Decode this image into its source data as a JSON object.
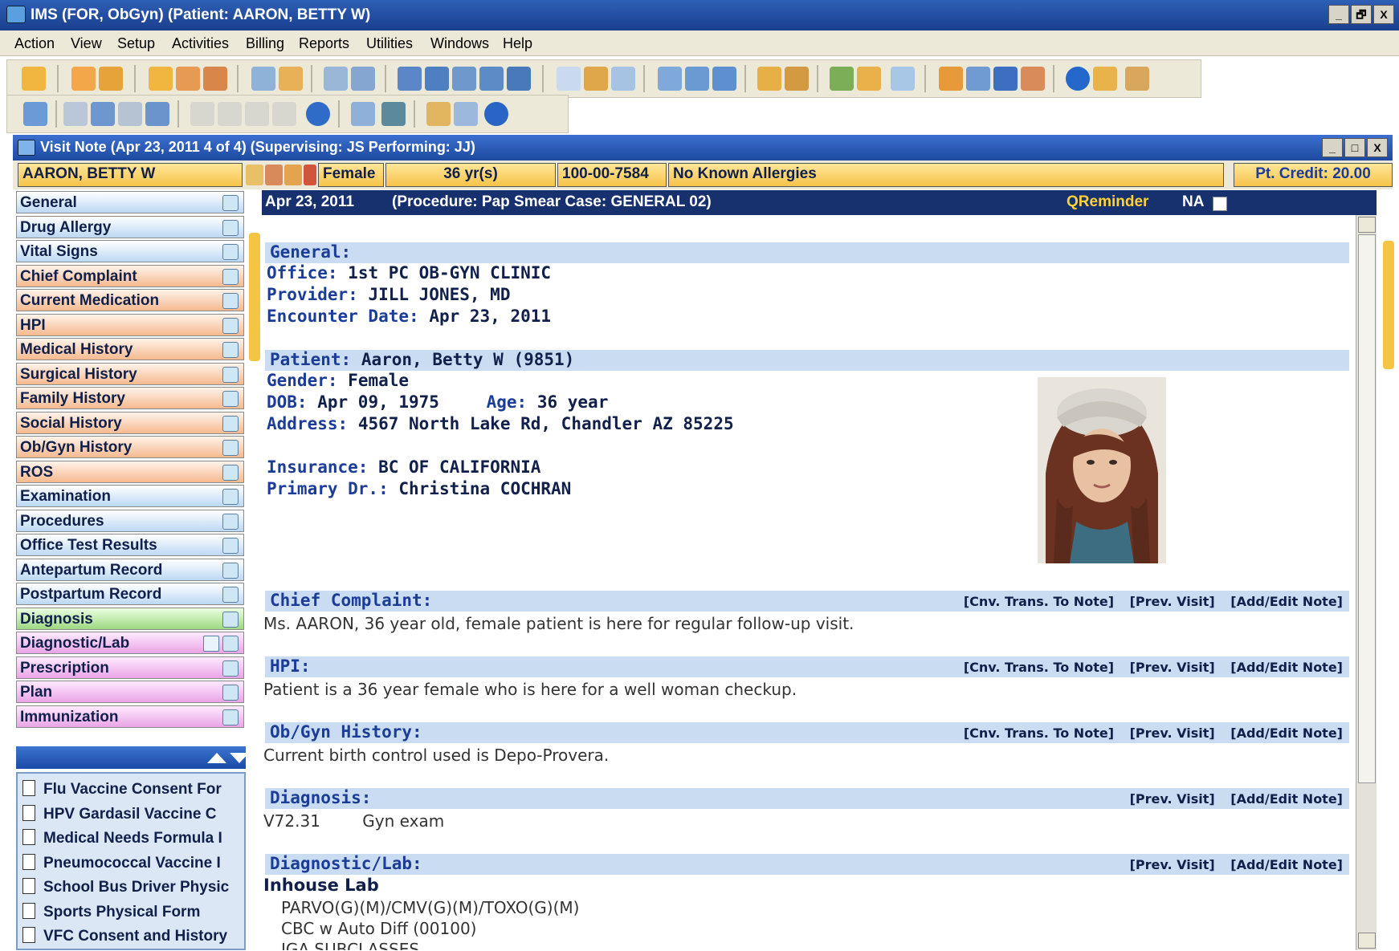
{
  "window": {
    "title": "IMS (FOR, ObGyn)   (Patient: AARON, BETTY  W)",
    "buttons": [
      "_",
      "🗗",
      "X"
    ]
  },
  "menu": [
    "Action",
    "View",
    "Setup",
    "Activities",
    "Billing",
    "Reports",
    "Utilities",
    "Windows",
    "Help"
  ],
  "visit_note": {
    "title": "Visit Note (Apr 23, 2011   4 of 4) (Supervising: JS Performing: JJ)",
    "buttons": [
      "_",
      "□",
      "X"
    ]
  },
  "patient_bar": {
    "name": "AARON, BETTY  W",
    "gender": "Female",
    "age": "36 yr(s)",
    "id": "100-00-7584",
    "allergies": "No Known Allergies",
    "credit": "Pt. Credit: 20.00"
  },
  "nav": {
    "items": [
      {
        "label": "General",
        "color": "blue"
      },
      {
        "label": "Drug Allergy",
        "color": "blue"
      },
      {
        "label": "Vital Signs",
        "color": "blue"
      },
      {
        "label": "Chief Complaint",
        "color": "orange"
      },
      {
        "label": "Current Medication",
        "color": "orange"
      },
      {
        "label": "HPI",
        "color": "orange"
      },
      {
        "label": "Medical History",
        "color": "orange"
      },
      {
        "label": "Surgical History",
        "color": "orange"
      },
      {
        "label": "Family History",
        "color": "orange"
      },
      {
        "label": "Social History",
        "color": "orange"
      },
      {
        "label": "Ob/Gyn History",
        "color": "orange"
      },
      {
        "label": "ROS",
        "color": "orange"
      },
      {
        "label": "Examination",
        "color": "blue"
      },
      {
        "label": "Procedures",
        "color": "blue"
      },
      {
        "label": "Office Test Results",
        "color": "blue"
      },
      {
        "label": "Antepartum Record",
        "color": "blue"
      },
      {
        "label": "Postpartum Record",
        "color": "blue"
      },
      {
        "label": "Diagnosis",
        "color": "green"
      },
      {
        "label": "Diagnostic/Lab",
        "color": "pink"
      },
      {
        "label": "Prescription",
        "color": "pink"
      },
      {
        "label": "Plan",
        "color": "pink"
      },
      {
        "label": "Immunization",
        "color": "pink"
      }
    ],
    "forms": [
      "Flu Vaccine Consent For",
      "HPV  Gardasil Vaccine C",
      "Medical Needs Formula I",
      "Pneumococcal Vaccine I",
      "School Bus Driver Physic",
      "Sports Physical Form",
      "VFC Consent and History"
    ]
  },
  "header": {
    "date": "Apr 23, 2011",
    "procedure": "(Procedure:  Pap Smear   Case: GENERAL 02)",
    "qreminder": "QReminder",
    "na": "NA"
  },
  "general": {
    "heading": "General:",
    "office_label": "Office:",
    "office": "1st PC OB-GYN CLINIC",
    "provider_label": "Provider:",
    "provider": "JILL JONES, MD",
    "encounter_label": "Encounter Date:",
    "encounter": "Apr 23, 2011"
  },
  "patient": {
    "heading_label": "Patient:",
    "heading_value": "Aaron, Betty  W   (9851)",
    "gender_label": "Gender:",
    "gender": "Female",
    "dob_label": "DOB:",
    "dob": "Apr 09, 1975",
    "age_label": "Age:",
    "age": "36 year",
    "address_label": "Address:",
    "address": "4567 North Lake Rd,  Chandler  AZ  85225",
    "insurance_label": "Insurance:",
    "insurance": "BC OF CALIFORNIA",
    "primary_label": "Primary Dr.:",
    "primary": "Christina  COCHRAN"
  },
  "links": {
    "conv": "[Cnv. Trans. To Note]",
    "prev": "[Prev. Visit]",
    "add": "[Add/Edit Note]"
  },
  "chief_complaint": {
    "heading": "Chief Complaint:",
    "text": "Ms. AARON, 36 year old, female patient is here for regular follow-up visit."
  },
  "hpi": {
    "heading": "HPI:",
    "text": "Patient is a 36 year female who is here for a well woman checkup."
  },
  "obgyn": {
    "heading": "Ob/Gyn History:",
    "text": "Current birth control used is Depo-Provera."
  },
  "diagnosis": {
    "heading": "Diagnosis:",
    "code": "V72.31",
    "desc": "Gyn exam"
  },
  "diaglab": {
    "heading": "Diagnostic/Lab:",
    "subheading": "Inhouse Lab",
    "items": [
      "PARVO(G)(M)/CMV(G)(M)/TOXO(G)(M)",
      "CBC w Auto Diff (00100)",
      "IGA SUBCLASSES"
    ]
  }
}
